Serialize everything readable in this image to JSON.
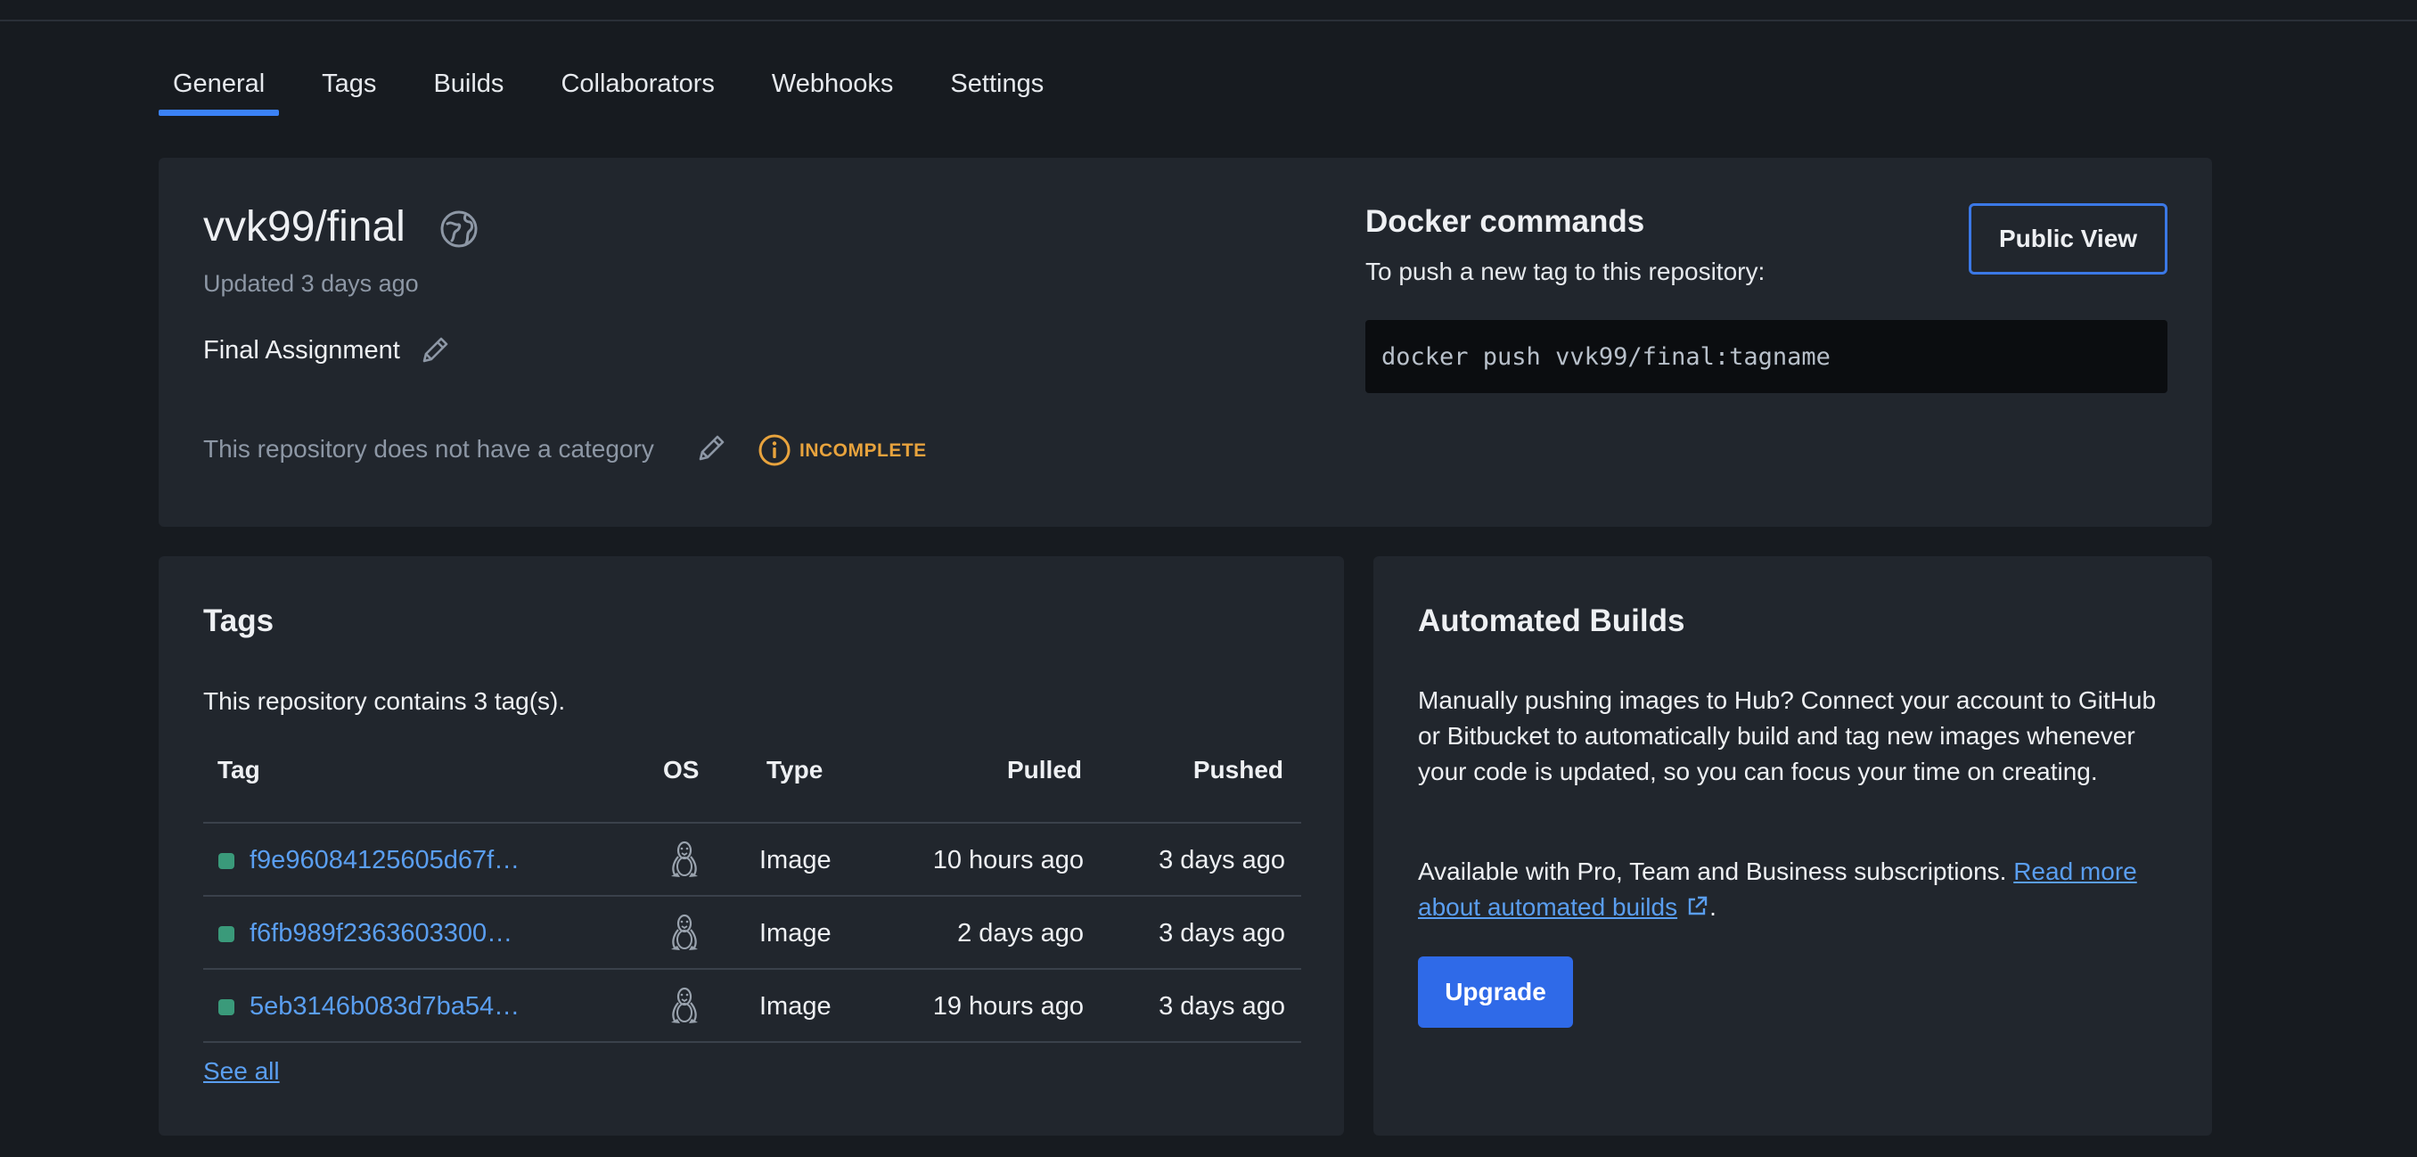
{
  "tabs": [
    {
      "label": "General",
      "active": true
    },
    {
      "label": "Tags"
    },
    {
      "label": "Builds"
    },
    {
      "label": "Collaborators"
    },
    {
      "label": "Webhooks"
    },
    {
      "label": "Settings"
    }
  ],
  "repo": {
    "title": "vvk99/final",
    "updated": "Updated 3 days ago",
    "description": "Final Assignment",
    "category": "This repository does not have a category",
    "status": "INCOMPLETE",
    "visibility_icon": "globe-icon"
  },
  "docker": {
    "heading": "Docker commands",
    "subtitle": "To push a new tag to this repository:",
    "command": "docker push vvk99/final:tagname",
    "public_view_label": "Public View"
  },
  "tags_card": {
    "heading": "Tags",
    "count_text": "This repository contains 3 tag(s).",
    "columns": [
      "Tag",
      "OS",
      "Type",
      "Pulled",
      "Pushed"
    ],
    "rows": [
      {
        "tag": "f9e96084125605d67f…",
        "os": "linux",
        "type": "Image",
        "pulled": "10 hours ago",
        "pushed": "3 days ago"
      },
      {
        "tag": "f6fb989f2363603300…",
        "os": "linux",
        "type": "Image",
        "pulled": "2 days ago",
        "pushed": "3 days ago"
      },
      {
        "tag": "5eb3146b083d7ba54…",
        "os": "linux",
        "type": "Image",
        "pulled": "19 hours ago",
        "pushed": "3 days ago"
      }
    ],
    "see_all": "See all"
  },
  "builds_card": {
    "heading": "Automated Builds",
    "paragraph1": "Manually pushing images to Hub? Connect your account to GitHub or Bitbucket to automatically build and tag new images whenever your code is updated, so you can focus your time on creating.",
    "paragraph2_prefix": "Available with Pro, Team and Business subscriptions. ",
    "link_text": "Read more about automated builds",
    "paragraph2_suffix": ".",
    "upgrade_label": "Upgrade"
  },
  "colors": {
    "background": "#171b20",
    "card": "#21262d",
    "accent": "#3b82f6",
    "link": "#5a9ef0",
    "warning": "#e8a33d",
    "tag_dot": "#3a9a7a"
  }
}
